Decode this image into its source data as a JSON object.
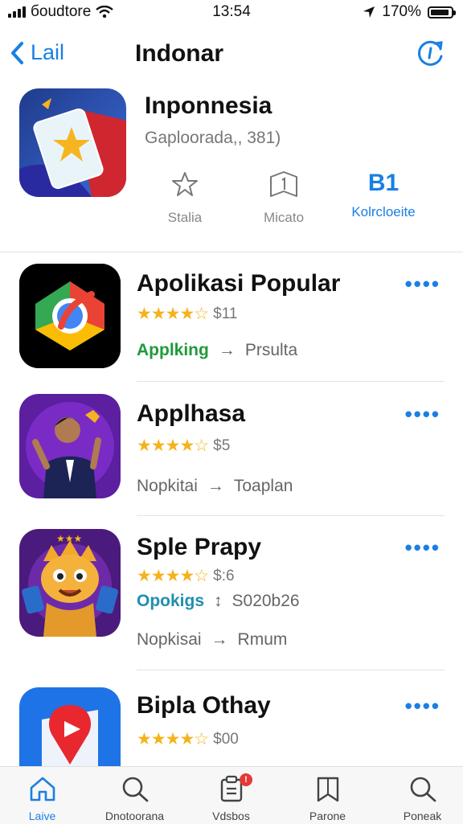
{
  "status_bar": {
    "carrier": "бoudtore",
    "time": "13:54",
    "battery": "170%"
  },
  "nav": {
    "back_label": "Lail",
    "title": "Indonar"
  },
  "hero": {
    "title": "Inponnesia",
    "subtitle": "Gaploorada,, 381)",
    "actions": [
      {
        "icon": "star-icon",
        "label": "Stalia"
      },
      {
        "icon": "bookmark-icon",
        "label": "Micato"
      },
      {
        "icon": "number-icon",
        "value": "B1",
        "label": "Kolrcloeite"
      }
    ]
  },
  "apps": [
    {
      "name": "Apolikasi Popular",
      "stars": "★★★★☆",
      "rating": 3.5,
      "price": "$11",
      "meta_left": "Applking",
      "meta_arrow": "→",
      "meta_right": "Prsulta"
    },
    {
      "name": "Applhasa",
      "stars": "★★★★☆",
      "rating": 4.5,
      "price": "$5",
      "meta_left": "Nopkitai",
      "meta_arrow": "→",
      "meta_right": "Toaplan"
    },
    {
      "name": "Sple Prapy",
      "stars": "★★★★☆",
      "rating": 4.5,
      "price": "$:6",
      "extra_left": "Opokigs",
      "extra_arrow": "↕",
      "extra_right": "S020b26",
      "meta_left": "Nopkisai",
      "meta_arrow": "→",
      "meta_right": "Rmum"
    },
    {
      "name": "Bipla Othay",
      "stars": "★★★★☆",
      "rating": 4.5,
      "price": "$00"
    }
  ],
  "more_label": "••••",
  "tabs": [
    {
      "label": "Laive",
      "icon": "home-icon",
      "active": true
    },
    {
      "label": "Dnotoorana",
      "icon": "search-icon"
    },
    {
      "label": "Vdsbos",
      "icon": "clipboard-icon",
      "badge": "!"
    },
    {
      "label": "Parone",
      "icon": "book-icon"
    },
    {
      "label": "Poneak",
      "icon": "search-icon"
    }
  ],
  "colors": {
    "accent": "#1a7fe3",
    "star": "#f5b31b",
    "green": "#1f9a3b",
    "teal": "#1f8fb0",
    "badge": "#e53935"
  }
}
